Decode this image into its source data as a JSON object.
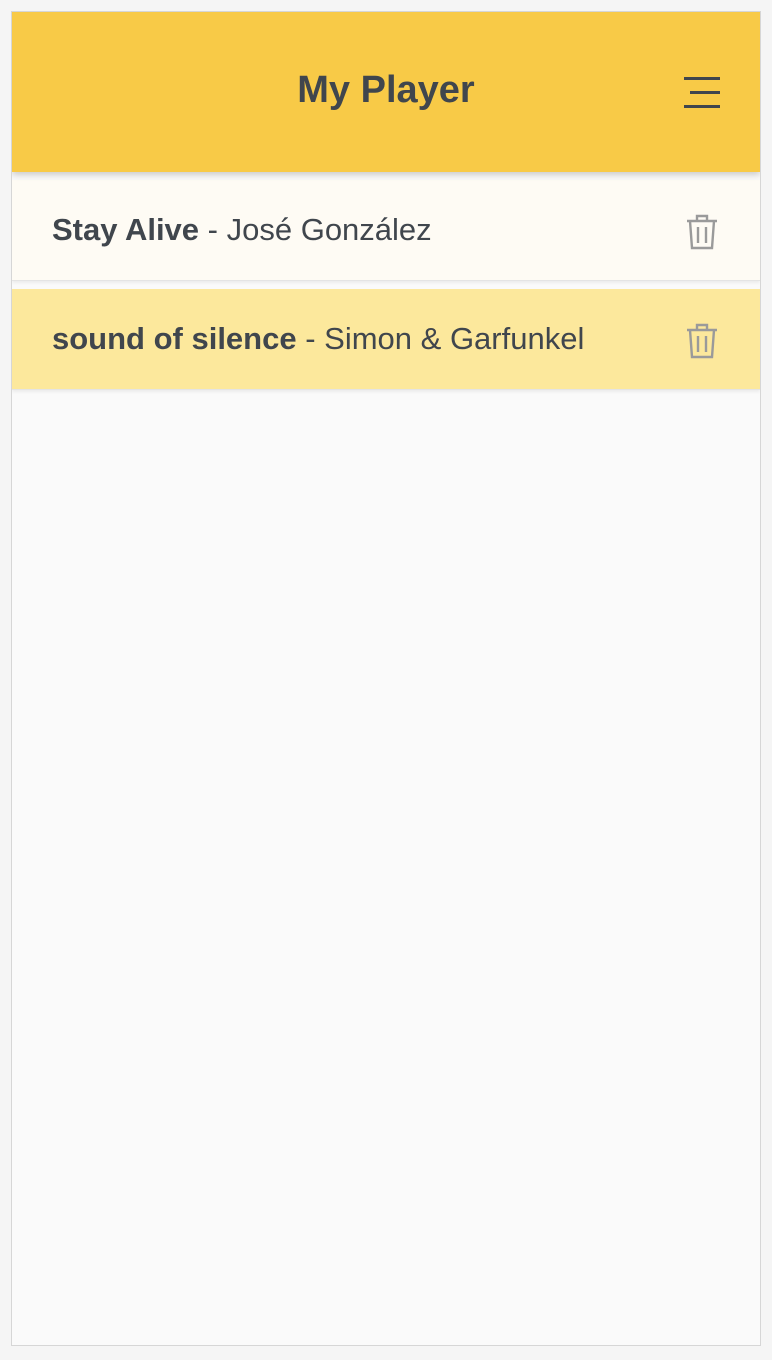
{
  "app": {
    "title": "My Player",
    "menu_icon": "menu-icon"
  },
  "colors": {
    "header_bg": "#f8ca47",
    "row_default_bg": "#fefbf4",
    "row_selected_bg": "#fce89c",
    "text": "#40464d",
    "icon": "#9a9a9a"
  },
  "playlist": {
    "items": [
      {
        "song": "Stay Alive",
        "separator": " - ",
        "artist": "José González",
        "selected": false,
        "delete_icon": "trash-icon"
      },
      {
        "song": "sound of silence",
        "separator": " - ",
        "artist": "Simon & Garfunkel",
        "selected": true,
        "delete_icon": "trash-icon"
      }
    ]
  }
}
